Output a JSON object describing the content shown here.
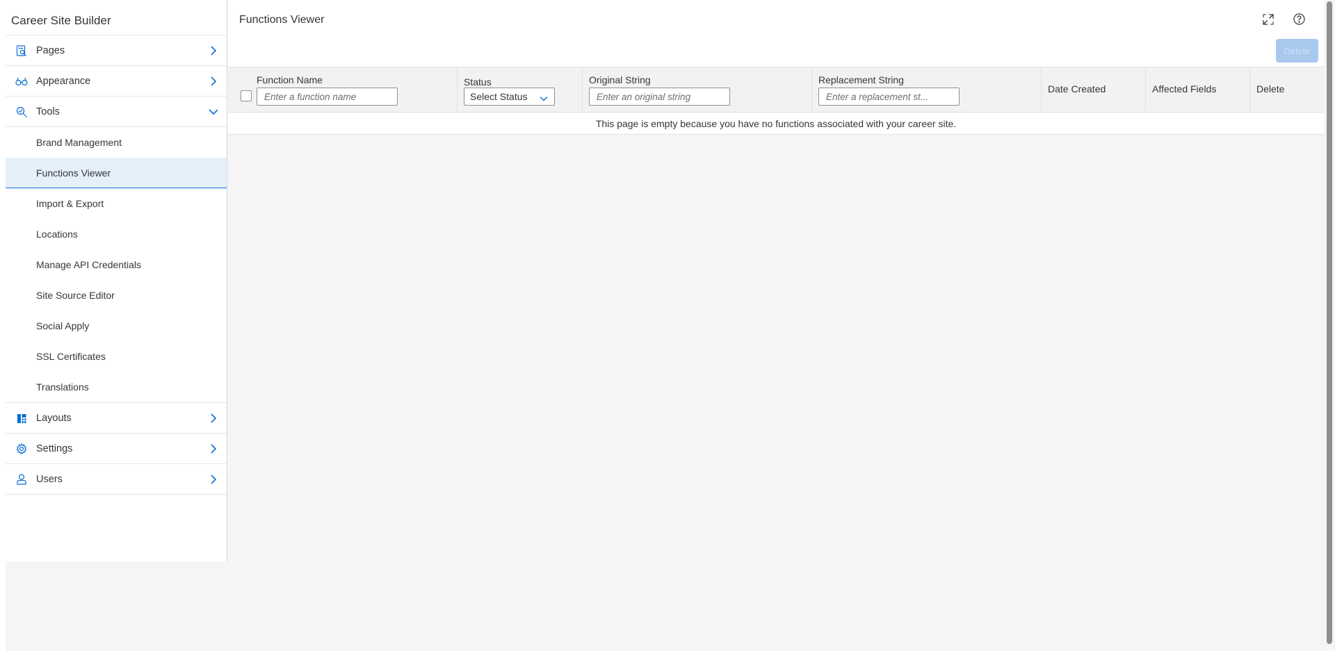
{
  "sidebar": {
    "title": "Career Site Builder",
    "items": [
      {
        "label": "Pages",
        "icon": "pages-icon"
      },
      {
        "label": "Appearance",
        "icon": "appearance-icon"
      },
      {
        "label": "Tools",
        "icon": "tools-icon"
      },
      {
        "label": "Layouts",
        "icon": "layouts-icon"
      },
      {
        "label": "Settings",
        "icon": "settings-icon"
      },
      {
        "label": "Users",
        "icon": "users-icon"
      }
    ],
    "tools_sub_items": [
      "Brand Management",
      "Functions Viewer",
      "Import & Export",
      "Locations",
      "Manage API Credentials",
      "Site Source Editor",
      "Social Apply",
      "SSL Certificates",
      "Translations"
    ],
    "active_sub_item": "Functions Viewer"
  },
  "header": {
    "title": "Functions Viewer",
    "delete_label": "Delete"
  },
  "table": {
    "columns": {
      "function_name": "Function Name",
      "status": "Status",
      "original_string": "Original String",
      "replacement_string": "Replacement String",
      "date_created": "Date Created",
      "affected_fields": "Affected Fields",
      "delete": "Delete"
    },
    "filters": {
      "function_name_placeholder": "Enter a function name",
      "status_value": "Select Status",
      "original_string_placeholder": "Enter an original string",
      "replacement_string_placeholder": "Enter a replacement st..."
    },
    "empty_message": "This page is empty because you have no functions associated with your career site."
  },
  "colors": {
    "accent": "#0a6ed1",
    "active_bg": "#e5f0fa",
    "disabled_button": "#a8c8ee"
  }
}
